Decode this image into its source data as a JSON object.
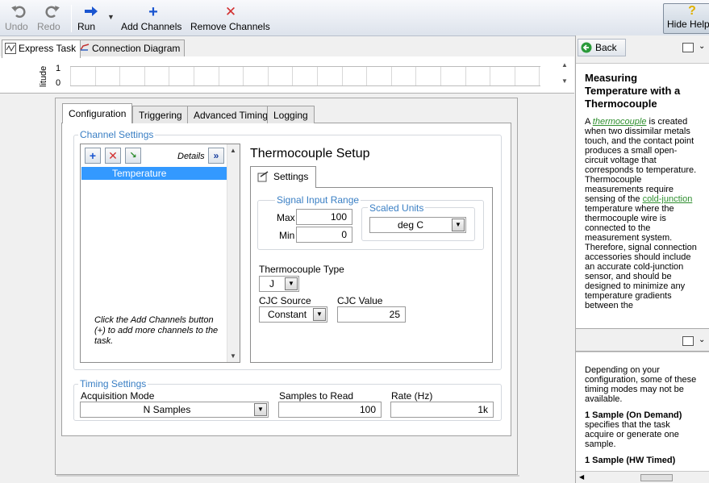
{
  "toolbar": {
    "undo": "Undo",
    "redo": "Redo",
    "run": "Run",
    "add_channels": "Add Channels",
    "remove_channels": "Remove Channels",
    "hide_help": "Hide Help"
  },
  "top_tabs": [
    "Express Task",
    "Connection Diagram"
  ],
  "graph": {
    "y_label": "litude",
    "y_ticks": [
      "1",
      "0"
    ]
  },
  "config_tabs": [
    "Configuration",
    "Triggering",
    "Advanced Timing",
    "Logging"
  ],
  "channel_settings": {
    "title": "Channel Settings",
    "details": "Details",
    "channels": [
      "Temperature"
    ],
    "hint": "Click the Add Channels button (+) to add more channels to the task."
  },
  "setup": {
    "title": "Thermocouple Setup",
    "tab": "Settings",
    "signal_range_title": "Signal Input Range",
    "max_label": "Max",
    "max_value": "100",
    "min_label": "Min",
    "min_value": "0",
    "scaled_units_title": "Scaled Units",
    "scaled_units_value": "deg C",
    "tc_type_label": "Thermocouple Type",
    "tc_type_value": "J",
    "cjc_source_label": "CJC Source",
    "cjc_source_value": "Constant",
    "cjc_value_label": "CJC Value",
    "cjc_value": "25"
  },
  "timing": {
    "title": "Timing Settings",
    "acq_mode_label": "Acquisition Mode",
    "acq_mode_value": "N Samples",
    "samples_label": "Samples to Read",
    "samples_value": "100",
    "rate_label": "Rate (Hz)",
    "rate_value": "1k"
  },
  "help": {
    "back": "Back",
    "heading": "Measuring Temperature with a Thermocouple",
    "p1_a": "A ",
    "p1_link": "thermocouple",
    "p1_b": " is created when two dissimilar metals touch, and the contact point produces a small open-circuit voltage that corresponds to temperature. Thermocouple measurements require sensing of the ",
    "p1_link2": "cold-junction",
    "p1_c": " temperature where the thermocouple wire is connected to the measurement system. Therefore, signal connection accessories should include an accurate cold-junction sensor, and should be designed to minimize any temperature gradients between the",
    "p2": "Depending on your configuration, some of these timing modes may not be available.",
    "p3_bold": "1 Sample (On Demand)",
    "p3": " specifies that the task acquire or generate one sample.",
    "p4_bold": "1 Sample (HW Timed)"
  },
  "colors": {
    "accent_blue": "#3a7fc4",
    "selection": "#3399ff",
    "link_green": "#2f8f2f",
    "remove_red": "#d23030"
  }
}
